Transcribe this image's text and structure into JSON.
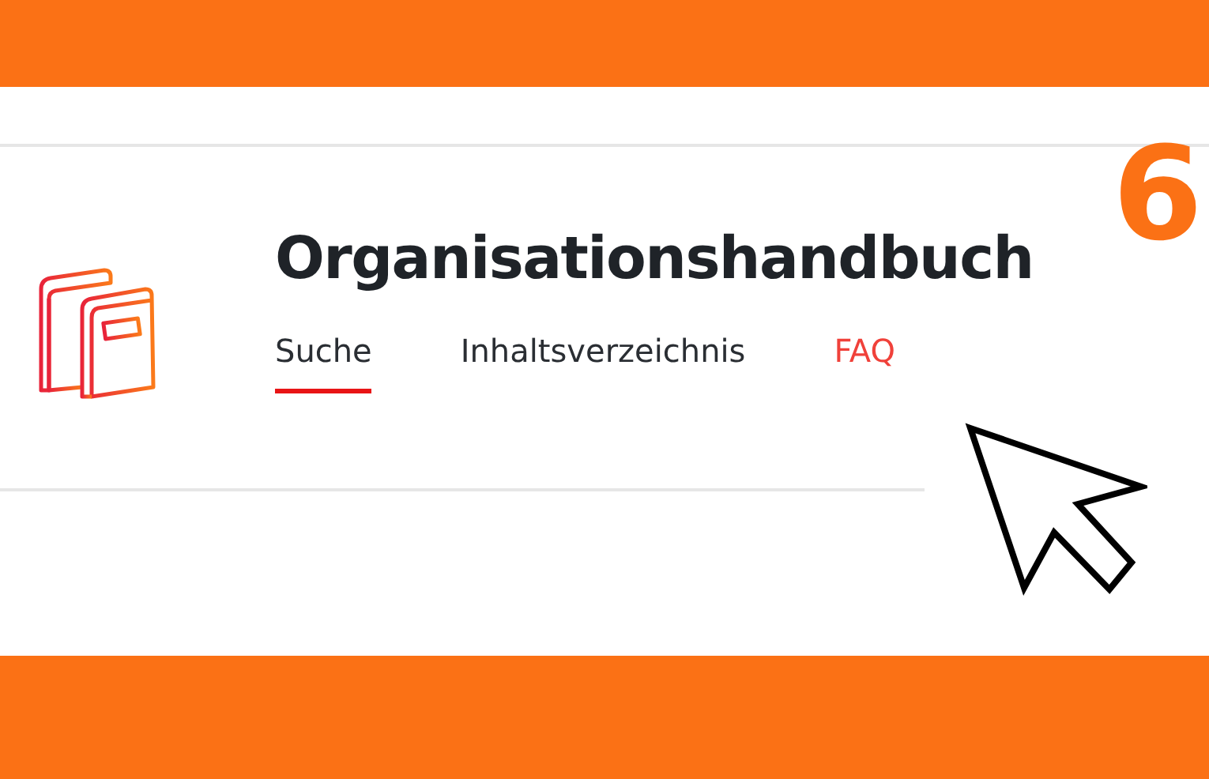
{
  "step": "6",
  "title": "Organisationshandbuch",
  "tabs": [
    {
      "label": "Suche",
      "selected": true,
      "hovered": false
    },
    {
      "label": "Inhaltsverzeichnis",
      "selected": false,
      "hovered": false
    },
    {
      "label": "FAQ",
      "selected": false,
      "hovered": true
    }
  ]
}
